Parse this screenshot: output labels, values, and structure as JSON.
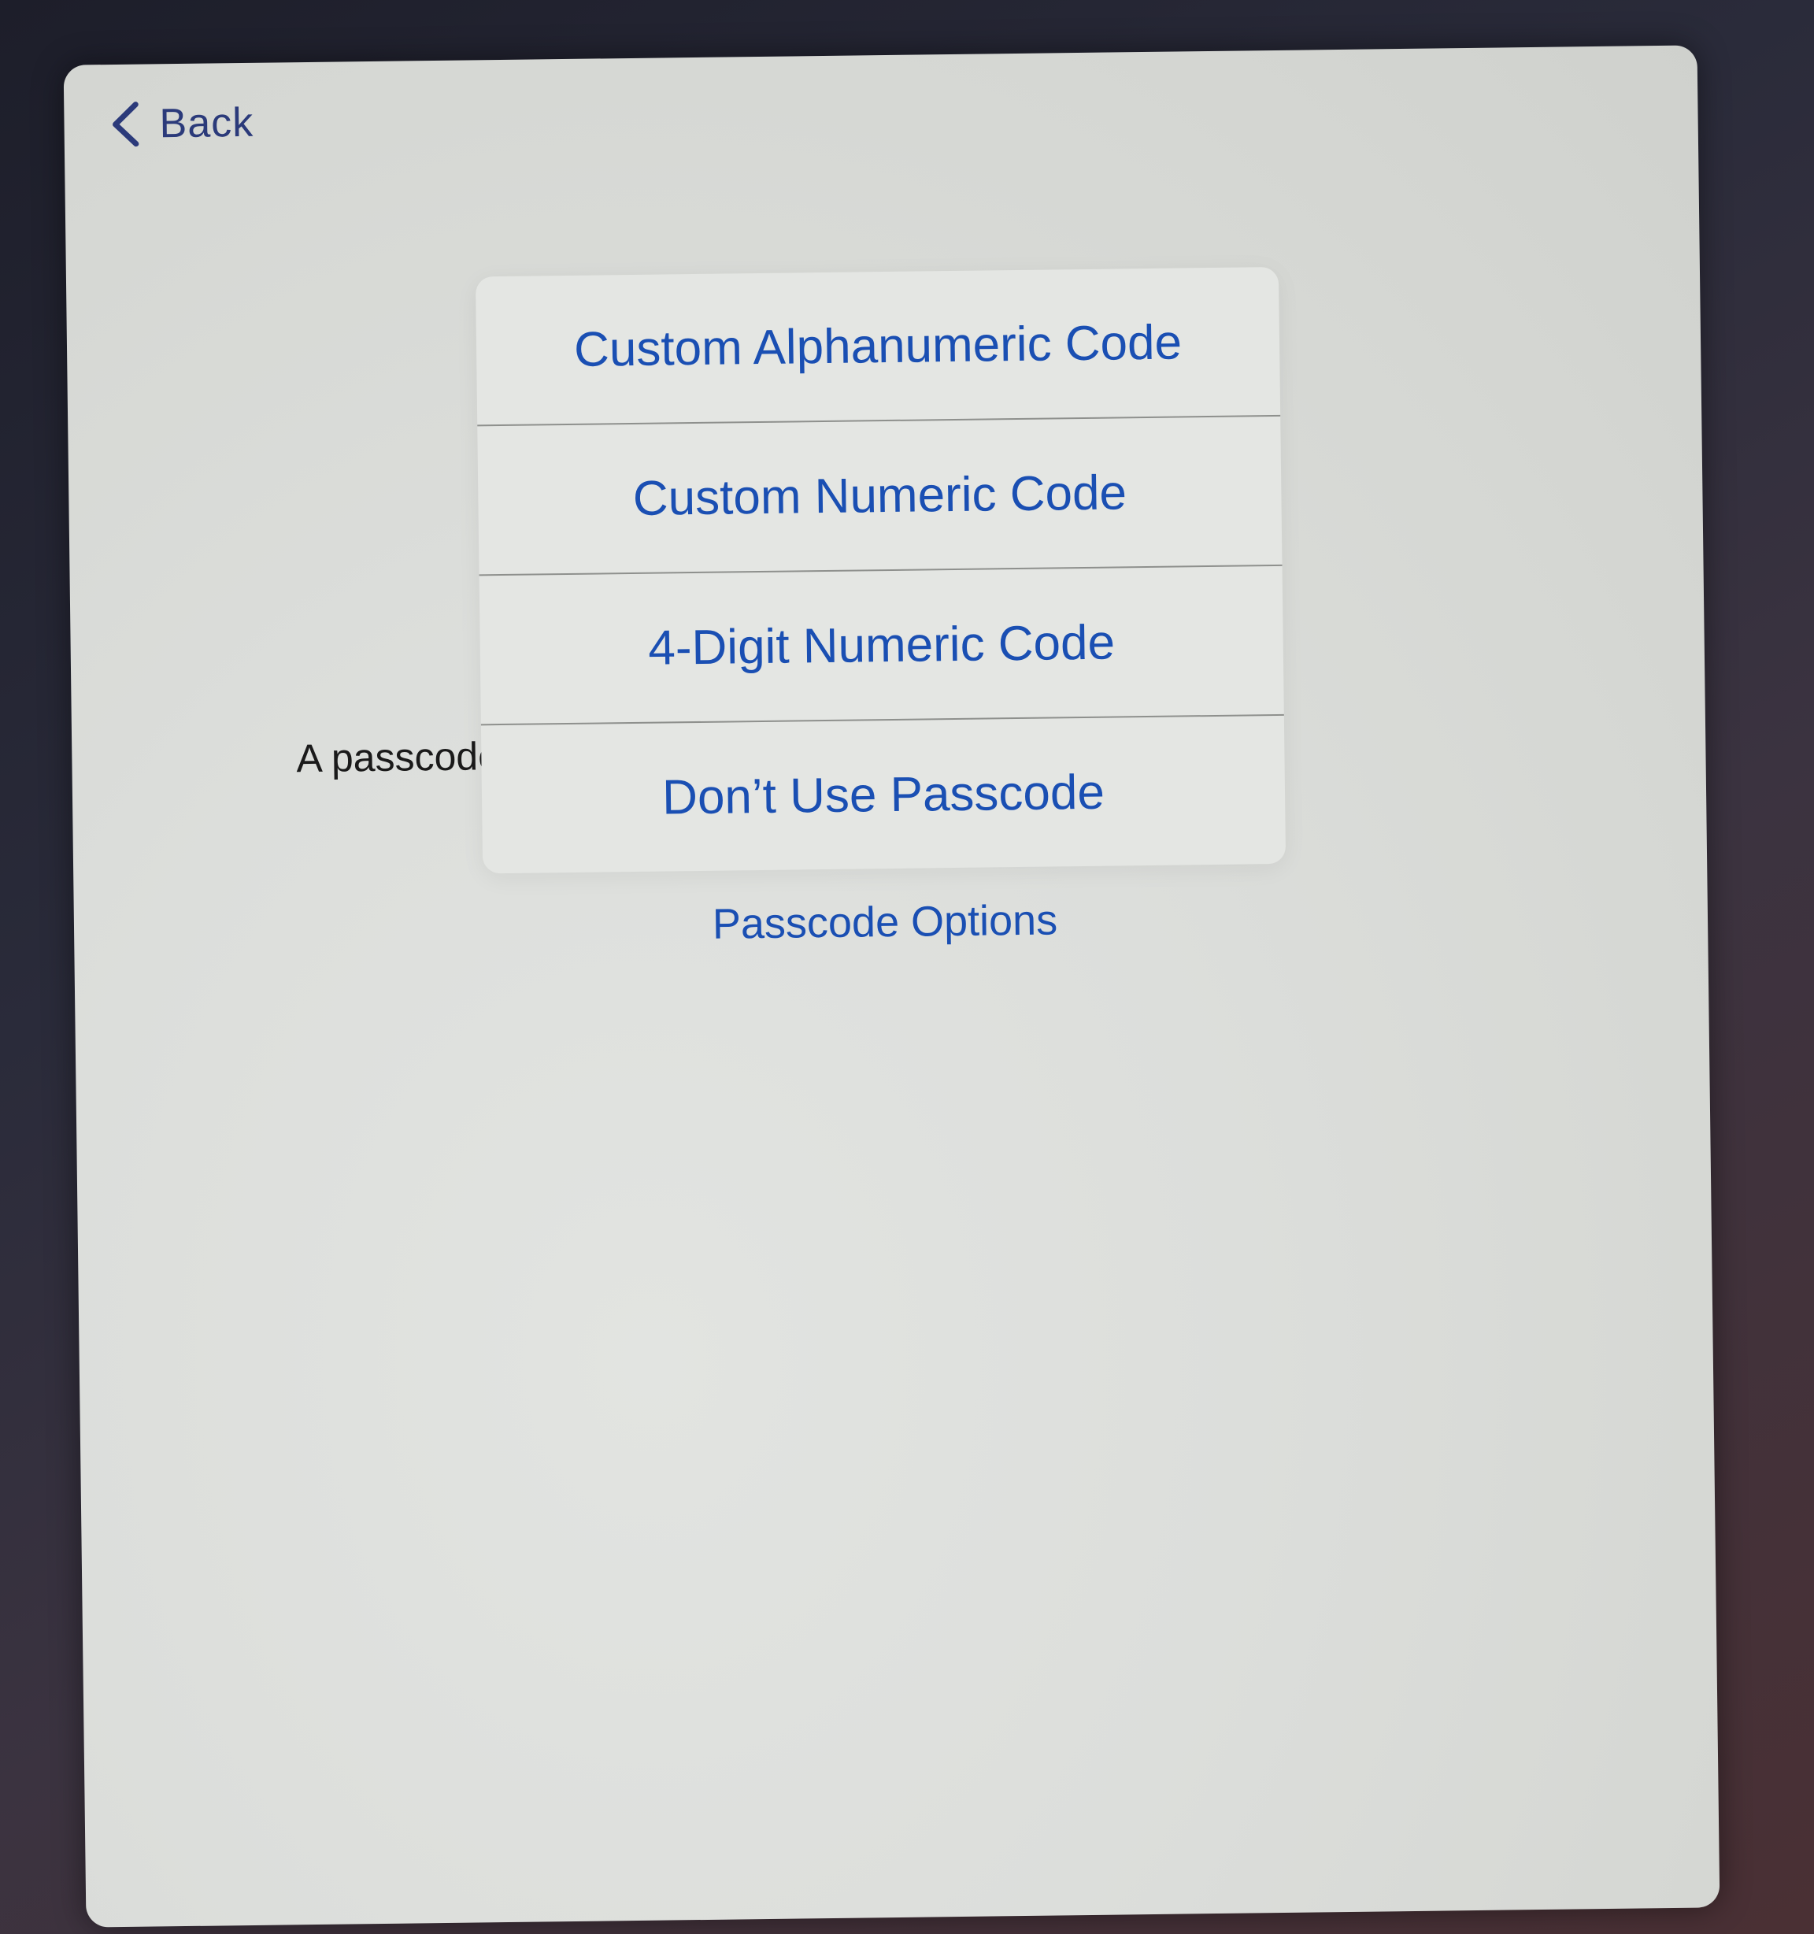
{
  "nav": {
    "back_label": "Back"
  },
  "description": {
    "text": "A passcode is required to unlock iPad."
  },
  "menu": {
    "items": [
      {
        "label": "Custom Alphanumeric Code"
      },
      {
        "label": "Custom Numeric Code"
      },
      {
        "label": "4-Digit Numeric Code"
      },
      {
        "label": "Don’t Use Passcode"
      }
    ]
  },
  "options": {
    "label": "Passcode Options"
  },
  "colors": {
    "accent": "#1a4fb3",
    "background": "#dcdedb",
    "text": "#1a1a1a"
  },
  "icons": {
    "back": "chevron-left-icon"
  }
}
